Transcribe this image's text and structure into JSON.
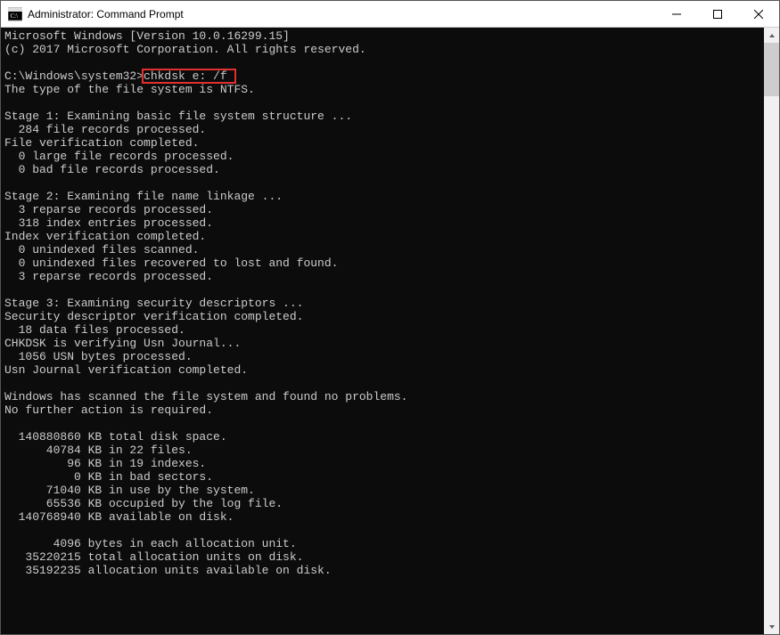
{
  "titlebar": {
    "title": "Administrator: Command Prompt"
  },
  "console": {
    "version_line": "Microsoft Windows [Version 10.0.16299.15]",
    "copyright_line": "(c) 2017 Microsoft Corporation. All rights reserved.",
    "prompt_prefix": "C:\\Windows\\system32>",
    "command": "chkdsk e: /f",
    "fs_type_line": "The type of the file system is NTFS.",
    "stage1_header": "Stage 1: Examining basic file system structure ...",
    "stage1_l1": "  284 file records processed.",
    "stage1_l2": "File verification completed.",
    "stage1_l3": "  0 large file records processed.",
    "stage1_l4": "  0 bad file records processed.",
    "stage2_header": "Stage 2: Examining file name linkage ...",
    "stage2_l1": "  3 reparse records processed.",
    "stage2_l2": "  318 index entries processed.",
    "stage2_l3": "Index verification completed.",
    "stage2_l4": "  0 unindexed files scanned.",
    "stage2_l5": "  0 unindexed files recovered to lost and found.",
    "stage2_l6": "  3 reparse records processed.",
    "stage3_header": "Stage 3: Examining security descriptors ...",
    "stage3_l1": "Security descriptor verification completed.",
    "stage3_l2": "  18 data files processed.",
    "stage3_l3": "CHKDSK is verifying Usn Journal...",
    "stage3_l4": "  1056 USN bytes processed.",
    "stage3_l5": "Usn Journal verification completed.",
    "result_l1": "Windows has scanned the file system and found no problems.",
    "result_l2": "No further action is required.",
    "disk_l1": "  140880860 KB total disk space.",
    "disk_l2": "      40784 KB in 22 files.",
    "disk_l3": "         96 KB in 19 indexes.",
    "disk_l4": "          0 KB in bad sectors.",
    "disk_l5": "      71040 KB in use by the system.",
    "disk_l6": "      65536 KB occupied by the log file.",
    "disk_l7": "  140768940 KB available on disk.",
    "alloc_l1": "       4096 bytes in each allocation unit.",
    "alloc_l2": "   35220215 total allocation units on disk.",
    "alloc_l3": "   35192235 allocation units available on disk."
  }
}
